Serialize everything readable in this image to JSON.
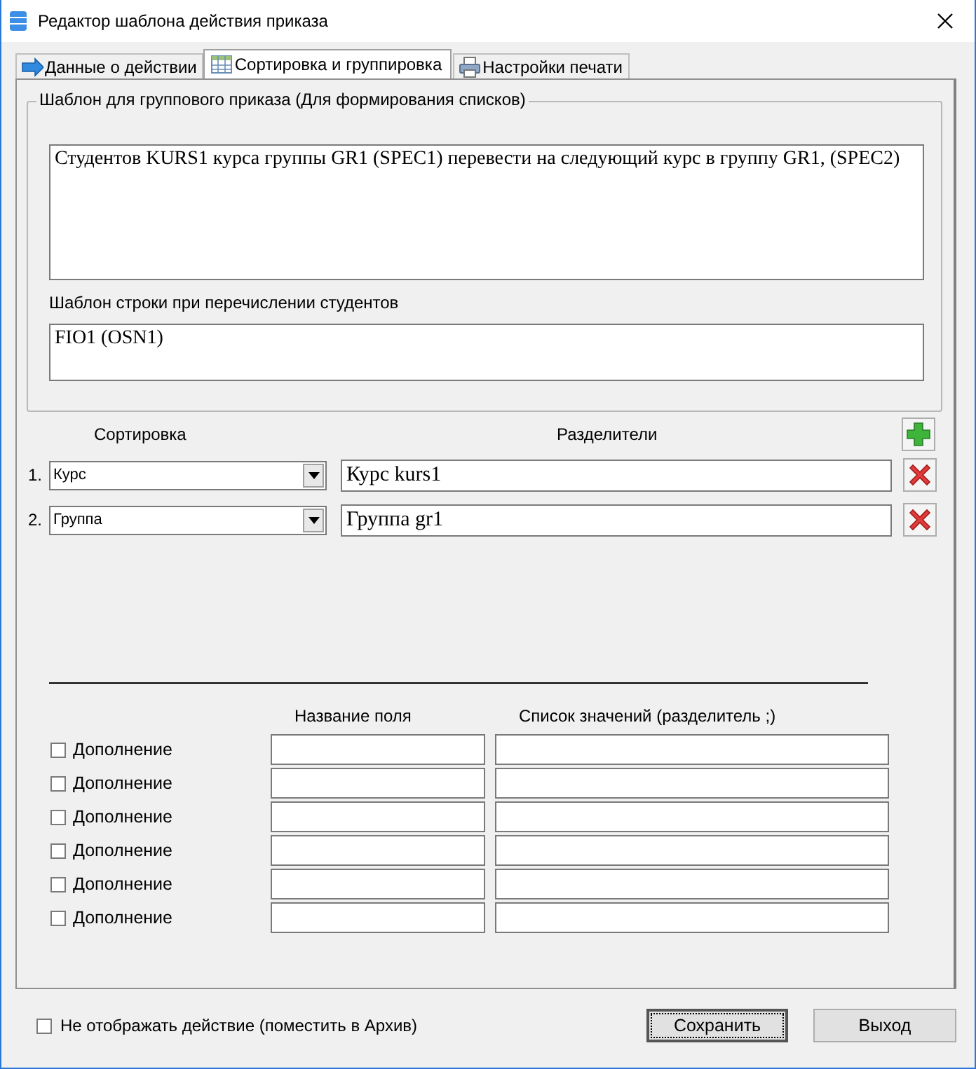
{
  "window": {
    "title": "Редактор шаблона действия приказа"
  },
  "tabs": [
    {
      "label": "Данные о действии",
      "kind": "arrow",
      "selected": false
    },
    {
      "label": "Сортировка и группировка",
      "kind": "table",
      "selected": true
    },
    {
      "label": "Настройки печати",
      "kind": "printer",
      "selected": false
    }
  ],
  "template_group": {
    "title": "Шаблон для группового приказа (Для формирования списков)",
    "value": "Студентов KURS1 курса группы GR1 (SPEC1) перевести на следующий курс в группу GR1, (SPEC2)",
    "row_label": "Шаблон строки при перечислении студентов",
    "row_value": "FIO1 (OSN1)"
  },
  "sorting": {
    "headers": [
      "Сортировка",
      "Разделители"
    ],
    "rows": [
      {
        "number": "1.",
        "field": "Курс",
        "separator": "Курс kurs1"
      },
      {
        "number": "2.",
        "field": "Группа",
        "separator": "Группа gr1"
      }
    ]
  },
  "extras": {
    "headers": [
      "Название поля",
      "Список значений (разделитель ;)"
    ],
    "rows": [
      {
        "label": "Дополнение",
        "checked": false
      },
      {
        "label": "Дополнение",
        "checked": false
      },
      {
        "label": "Дополнение",
        "checked": false
      },
      {
        "label": "Дополнение",
        "checked": false
      },
      {
        "label": "Дополнение",
        "checked": false
      },
      {
        "label": "Дополнение",
        "checked": false
      }
    ]
  },
  "archive": {
    "label": "Не отображать действие (поместить в Архив)",
    "checked": false
  },
  "buttons": [
    {
      "label": "Сохранить",
      "default": true
    },
    {
      "label": "Выход",
      "default": false
    }
  ]
}
